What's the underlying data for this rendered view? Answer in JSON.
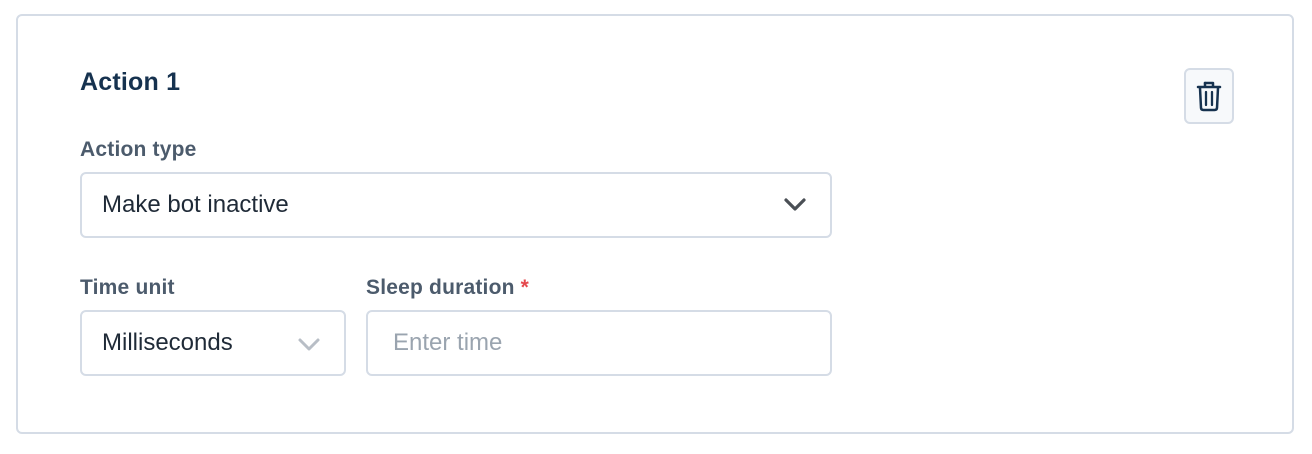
{
  "action": {
    "title": "Action 1",
    "delete_icon": "trash-icon"
  },
  "action_type": {
    "label": "Action type",
    "value": "Make bot inactive",
    "icon": "chevron-down-icon"
  },
  "time_unit": {
    "label": "Time unit",
    "value": "Milliseconds",
    "icon": "chevron-down-icon"
  },
  "sleep_duration": {
    "label": "Sleep duration",
    "required_marker": "*",
    "placeholder": "Enter time"
  },
  "colors": {
    "title": "#16324f",
    "label": "#4c5b6c",
    "border": "#d5dce6",
    "required": "#e5484d",
    "placeholder": "#9aa4af"
  }
}
